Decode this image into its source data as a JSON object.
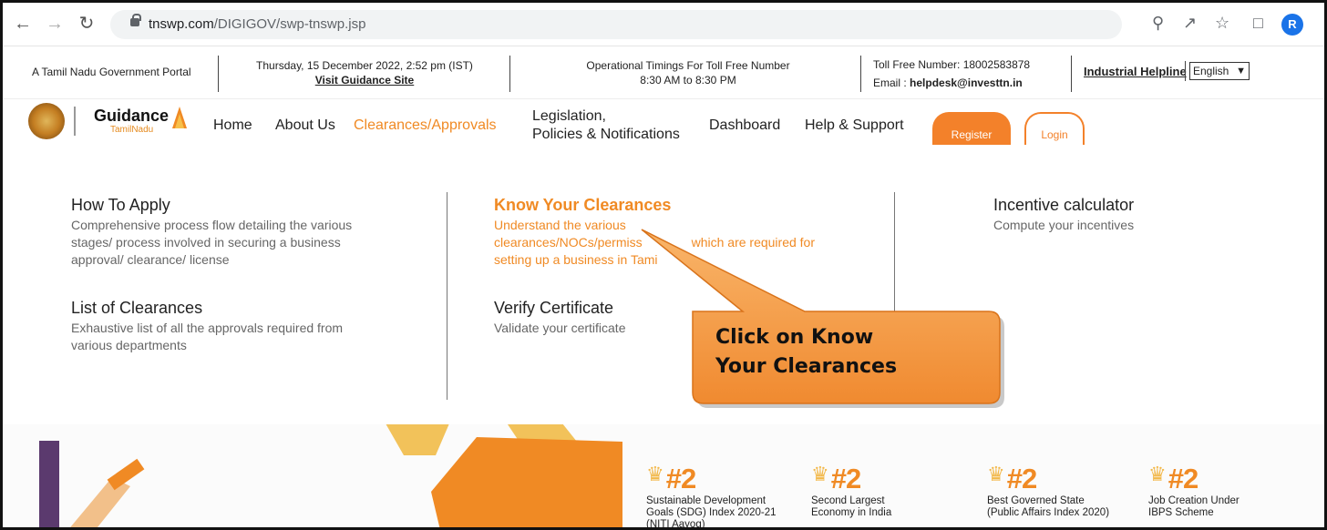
{
  "browser": {
    "url_domain": "tnswp.com",
    "url_path": "/DIGIGOV/swp-tnswp.jsp",
    "avatar_letter": "R"
  },
  "topbar": {
    "portal_label": "A Tamil Nadu Government Portal",
    "datetime": "Thursday, 15 December 2022, 2:52 pm (IST)",
    "visit_link": "Visit Guidance Site",
    "timings_title": "Operational Timings For Toll Free Number",
    "timings_hours": "8:30 AM to 8:30 PM",
    "toll_free": "Toll Free Number: 18002583878",
    "email_label": "Email :",
    "email": "helpdesk@investtn.in",
    "helpline": "Industrial Helpline",
    "language": "English"
  },
  "nav": {
    "brand": "Guidance",
    "brand_sub": "TamilNadu",
    "items": [
      "Home",
      "About Us",
      "Clearances/Approvals",
      "Legislation,",
      "Policies & Notifications",
      "Dashboard",
      "Help & Support"
    ],
    "register": "Register",
    "login": "Login"
  },
  "menu": {
    "how_to_apply_title": "How To Apply",
    "how_to_apply_desc": [
      "Comprehensive process flow detailing the various",
      "stages/ process involved in securing a business",
      "approval/ clearance/ license"
    ],
    "list_title": "List of Clearances",
    "list_desc": [
      "Exhaustive list of all the approvals required from",
      "various departments"
    ],
    "kyc_title": "Know Your Clearances",
    "kyc_desc": [
      "Understand the various",
      "clearances/NOCs/permiss",
      "which are required for",
      "setting up a business in Tami"
    ],
    "verify_title": "Verify Certificate",
    "verify_desc": "Validate your certificate",
    "incentive_title": "Incentive calculator",
    "incentive_desc": "Compute your incentives"
  },
  "callout": {
    "line1": "Click on Know",
    "line2": "Your Clearances"
  },
  "rankings": [
    {
      "rank": "#2",
      "caption": [
        "Sustainable Development",
        "Goals (SDG) Index 2020-21",
        "(NITI Aayog)"
      ]
    },
    {
      "rank": "#2",
      "caption": [
        "Second Largest",
        "Economy in India"
      ]
    },
    {
      "rank": "#2",
      "caption": [
        "Best Governed State",
        "(Public Affairs Index 2020)"
      ]
    },
    {
      "rank": "#2",
      "caption": [
        "Job Creation Under",
        "IBPS Scheme"
      ]
    }
  ],
  "colors": {
    "accent": "#f08a24",
    "callout_fill": "#f7a24e"
  }
}
